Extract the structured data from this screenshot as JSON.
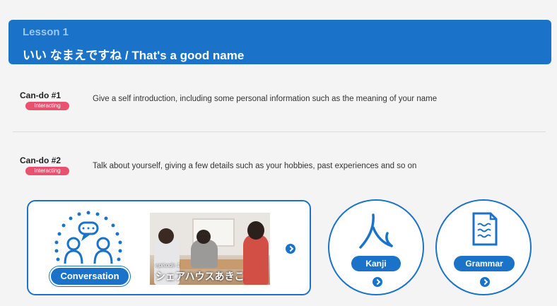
{
  "lesson": {
    "number": "Lesson 1",
    "title": "いい なまえですね / That's a good name"
  },
  "cando": [
    {
      "label": "Can-do #1",
      "badge": "Interacting",
      "text": "Give a self introduction, including some personal information such as the meaning of your name"
    },
    {
      "label": "Can-do #2",
      "badge": "Interacting",
      "text": "Talk about yourself, giving a few details such as your hobbies, past experiences and so on"
    }
  ],
  "conversation": {
    "label": "Conversation",
    "episode_small": "episode 1",
    "episode_title": "シェアハウスあきこ"
  },
  "kanji": {
    "label": "Kanji",
    "glyph": "人"
  },
  "grammar": {
    "label": "Grammar"
  },
  "icons": {
    "arrow": "chevron-right-icon",
    "conversation": "conversation-people-icon",
    "kanji": "kanji-glyph-icon",
    "grammar": "document-icon"
  },
  "colors": {
    "accent": "#1a73c8",
    "badge": "#e8526e",
    "background": "#f4f4f4"
  }
}
